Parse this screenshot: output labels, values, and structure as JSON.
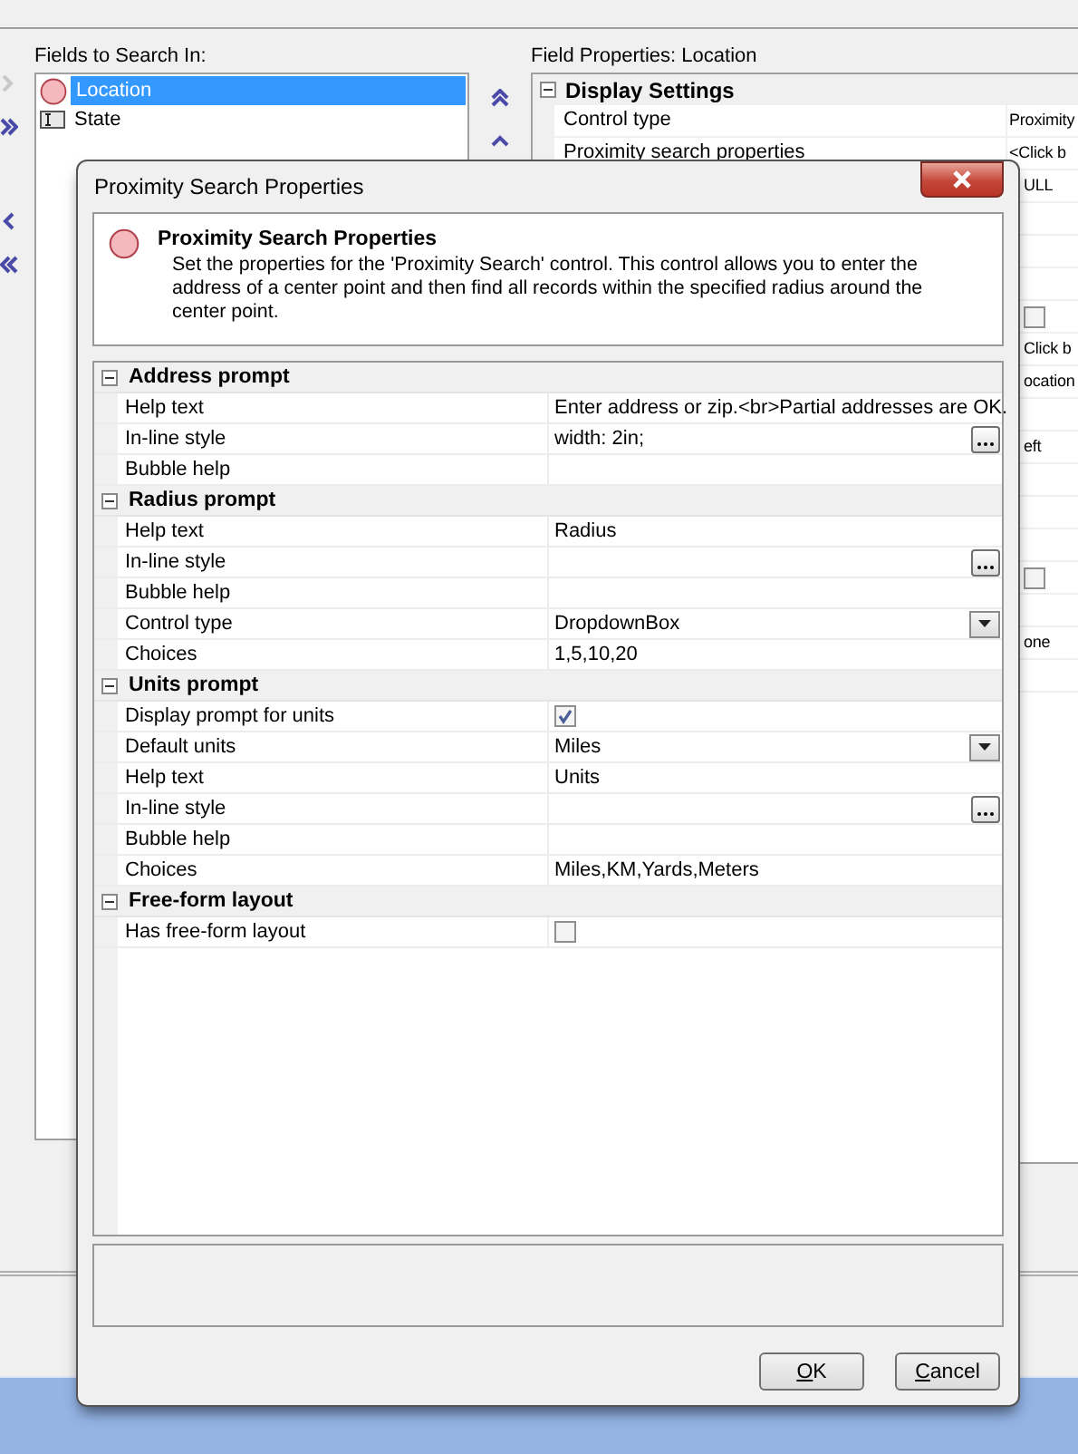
{
  "background": {
    "fields_label": "Fields to Search In:",
    "fields": [
      {
        "name": "Location",
        "kind": "proximity",
        "selected": true
      },
      {
        "name": "State",
        "kind": "text",
        "selected": false
      }
    ],
    "properties_label": "Field Properties:",
    "properties_field": "Location",
    "properties_section": {
      "name": "Display Settings",
      "expanded": true
    },
    "property_rows": [
      {
        "kind": "text",
        "label": "Control type",
        "value": "Proximity"
      },
      {
        "kind": "text",
        "label": "Proximity search properties",
        "value": "<Click b"
      },
      {
        "kind": "text",
        "value": "ULL"
      },
      {
        "kind": "text"
      },
      {
        "kind": "text"
      },
      {
        "kind": "text"
      },
      {
        "kind": "checkbox",
        "checked": false
      },
      {
        "kind": "text",
        "value": "Click b"
      },
      {
        "kind": "text",
        "value": "ocation"
      },
      {
        "kind": "text"
      },
      {
        "kind": "text",
        "value": "eft"
      },
      {
        "kind": "text"
      },
      {
        "kind": "text"
      },
      {
        "kind": "text"
      },
      {
        "kind": "checkbox",
        "checked": false
      },
      {
        "kind": "text"
      },
      {
        "kind": "text",
        "value": "one"
      },
      {
        "kind": "text"
      }
    ]
  },
  "dialog": {
    "title": "Proximity Search Properties",
    "heading": "Proximity Search Properties",
    "description": "Set the properties for the 'Proximity Search' control. This control allows you to enter the address of a center point and then find all records within the specified radius around the center point.",
    "sections": [
      {
        "name": "Address prompt",
        "expanded": true,
        "rows": [
          {
            "kind": "text",
            "label": "Help text",
            "value": "Enter address or zip.<br>Partial addresses are OK."
          },
          {
            "kind": "ellipsis",
            "label": "In-line style",
            "value": "width: 2in;",
            "button": true
          },
          {
            "kind": "text",
            "label": "Bubble help"
          }
        ]
      },
      {
        "name": "Radius prompt",
        "expanded": true,
        "rows": [
          {
            "kind": "text",
            "label": "Help text",
            "value": "Radius"
          },
          {
            "kind": "ellipsis",
            "label": "In-line style",
            "button": true
          },
          {
            "kind": "text",
            "label": "Bubble help"
          },
          {
            "kind": "dropdown",
            "label": "Control type",
            "value": "DropdownBox"
          },
          {
            "kind": "text",
            "label": "Choices",
            "value": "1,5,10,20"
          }
        ]
      },
      {
        "name": "Units prompt",
        "expanded": true,
        "rows": [
          {
            "kind": "checkbox",
            "label": "Display prompt for units",
            "checked": true
          },
          {
            "kind": "dropdown",
            "label": "Default units",
            "value": "Miles"
          },
          {
            "kind": "text",
            "label": "Help text",
            "value": "Units"
          },
          {
            "kind": "ellipsis",
            "label": "In-line style",
            "button": true
          },
          {
            "kind": "text",
            "label": "Bubble help"
          },
          {
            "kind": "text",
            "label": "Choices",
            "value": "Miles,KM,Yards,Meters"
          }
        ]
      },
      {
        "name": "Free-form layout",
        "expanded": true,
        "rows": [
          {
            "kind": "checkbox",
            "label": "Has free-form layout",
            "checked": false
          }
        ]
      }
    ],
    "buttons": [
      {
        "mnemonic": "O",
        "rest": "K"
      },
      {
        "mnemonic": "C",
        "rest": "ancel"
      }
    ]
  }
}
